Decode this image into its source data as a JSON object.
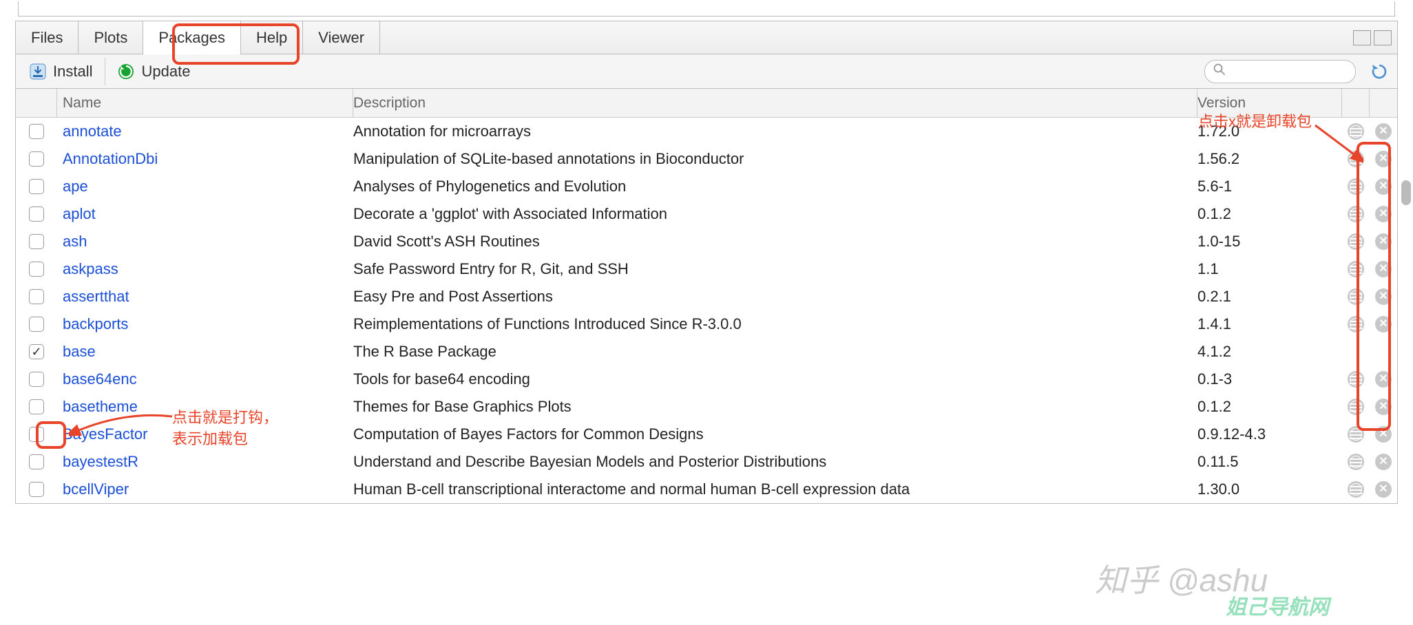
{
  "tabs": {
    "files": "Files",
    "plots": "Plots",
    "packages": "Packages",
    "help": "Help",
    "viewer": "Viewer"
  },
  "toolbar": {
    "install": "Install",
    "update": "Update",
    "search_placeholder": ""
  },
  "columns": {
    "name": "Name",
    "description": "Description",
    "version": "Version"
  },
  "packages": [
    {
      "checked": false,
      "name": "annotate",
      "desc": "Annotation for microarrays",
      "ver": "1.72.0",
      "web": true,
      "remove": true
    },
    {
      "checked": false,
      "name": "AnnotationDbi",
      "desc": "Manipulation of SQLite-based annotations in Bioconductor",
      "ver": "1.56.2",
      "web": true,
      "remove": true
    },
    {
      "checked": false,
      "name": "ape",
      "desc": "Analyses of Phylogenetics and Evolution",
      "ver": "5.6-1",
      "web": true,
      "remove": true
    },
    {
      "checked": false,
      "name": "aplot",
      "desc": "Decorate a 'ggplot' with Associated Information",
      "ver": "0.1.2",
      "web": true,
      "remove": true
    },
    {
      "checked": false,
      "name": "ash",
      "desc": "David Scott's ASH Routines",
      "ver": "1.0-15",
      "web": true,
      "remove": true
    },
    {
      "checked": false,
      "name": "askpass",
      "desc": "Safe Password Entry for R, Git, and SSH",
      "ver": "1.1",
      "web": true,
      "remove": true
    },
    {
      "checked": false,
      "name": "assertthat",
      "desc": "Easy Pre and Post Assertions",
      "ver": "0.2.1",
      "web": true,
      "remove": true
    },
    {
      "checked": false,
      "name": "backports",
      "desc": "Reimplementations of Functions Introduced Since R-3.0.0",
      "ver": "1.4.1",
      "web": true,
      "remove": true
    },
    {
      "checked": true,
      "name": "base",
      "desc": "The R Base Package",
      "ver": "4.1.2",
      "web": false,
      "remove": false
    },
    {
      "checked": false,
      "name": "base64enc",
      "desc": "Tools for base64 encoding",
      "ver": "0.1-3",
      "web": true,
      "remove": true
    },
    {
      "checked": false,
      "name": "basetheme",
      "desc": "Themes for Base Graphics Plots",
      "ver": "0.1.2",
      "web": true,
      "remove": true
    },
    {
      "checked": false,
      "name": "BayesFactor",
      "desc": "Computation of Bayes Factors for Common Designs",
      "ver": "0.9.12-4.3",
      "web": true,
      "remove": true
    },
    {
      "checked": false,
      "name": "bayestestR",
      "desc": "Understand and Describe Bayesian Models and Posterior Distributions",
      "ver": "0.11.5",
      "web": true,
      "remove": true
    },
    {
      "checked": false,
      "name": "bcellViper",
      "desc": "Human B-cell transcriptional interactome and normal human B-cell expression data",
      "ver": "1.30.0",
      "web": true,
      "remove": true
    }
  ],
  "annotations": {
    "check_note": "点击就是打钩，\n表示加载包",
    "remove_note": "点击x就是卸载包"
  },
  "watermarks": {
    "zhihu": "知乎 @ashu",
    "nav": "姐己导航网"
  }
}
